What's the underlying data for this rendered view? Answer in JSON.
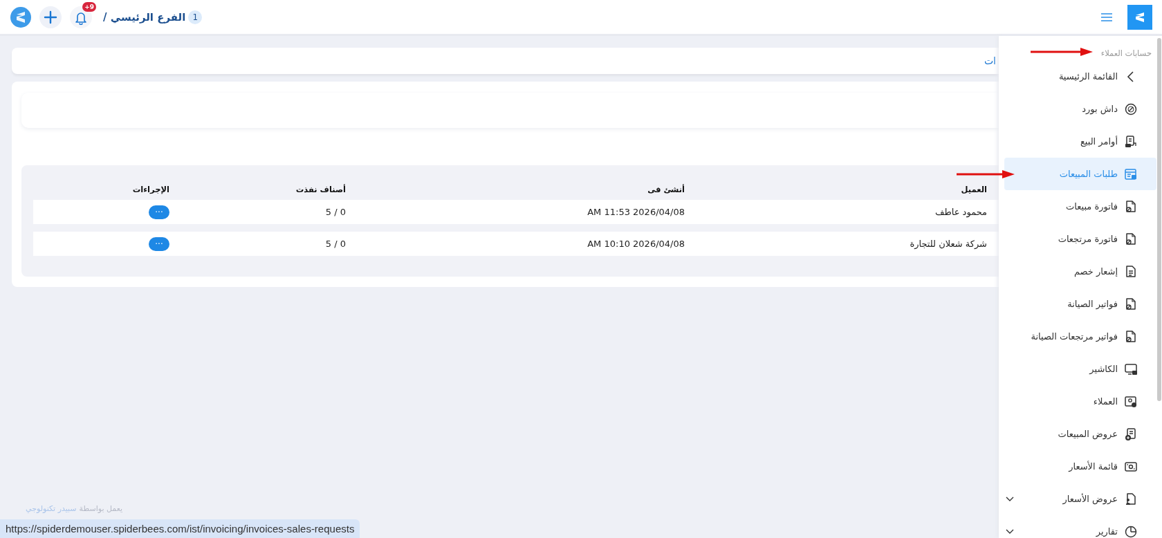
{
  "topbar": {
    "branch_count": "1",
    "branch_label": "الفرع الرئيسي /",
    "notification_badge": "+9"
  },
  "page_title": "ات",
  "table": {
    "columns": [
      "العميل",
      "أنشئ فى",
      "أصناف نفذت",
      "الإجراءات"
    ],
    "rows": [
      {
        "cells": [
          "محمود عاطف",
          "2026/04/08 11:53 AM",
          "0 / 5"
        ],
        "action": "···"
      },
      {
        "cells": [
          "شركة شعلان للتجارة",
          "2026/04/08 10:10 AM",
          "0 / 5"
        ],
        "action": "···"
      }
    ]
  },
  "footer": {
    "text": "يعمل بواسطة",
    "link": "سبيدر تكنولوجي"
  },
  "sidebar": {
    "section_title": "حسابات العملاء",
    "items": [
      {
        "label": "القائمة الرئيسية",
        "kind": "back",
        "selected": false
      },
      {
        "label": "داش بورد",
        "kind": "link",
        "selected": false
      },
      {
        "label": "أوامر البيع",
        "kind": "link",
        "selected": false
      },
      {
        "label": "طلبات المبيعات",
        "kind": "link",
        "selected": true
      },
      {
        "label": "فاتورة مبيعات",
        "kind": "link",
        "selected": false
      },
      {
        "label": "فاتورة مرتجعات",
        "kind": "link",
        "selected": false
      },
      {
        "label": "إشعار خصم",
        "kind": "link",
        "selected": false
      },
      {
        "label": "فواتير الصيانة",
        "kind": "link",
        "selected": false
      },
      {
        "label": "فواتير مرتجعات الصيانة",
        "kind": "link",
        "selected": false
      },
      {
        "label": "الكاشير",
        "kind": "link",
        "selected": false
      },
      {
        "label": "العملاء",
        "kind": "link",
        "selected": false
      },
      {
        "label": "عروض المبيعات",
        "kind": "link",
        "selected": false
      },
      {
        "label": "قائمة الأسعار",
        "kind": "link",
        "selected": false
      },
      {
        "label": "عروض الأسعار",
        "kind": "group",
        "selected": false,
        "expanded": false
      },
      {
        "label": "تقارير",
        "kind": "group",
        "selected": false,
        "expanded": false
      }
    ]
  },
  "status_bar": {
    "url": "https://spiderdemouser.spiderbees.com/ist/invoicing/invoices-sales-requests"
  }
}
